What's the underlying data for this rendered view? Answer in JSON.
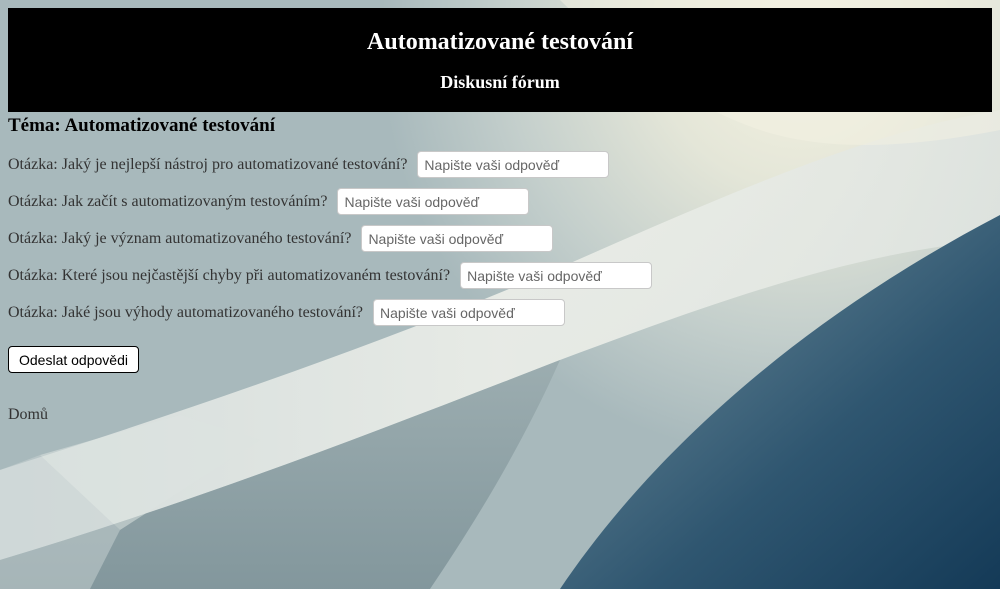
{
  "header": {
    "title": "Automatizované testování",
    "subtitle": "Diskusní fórum"
  },
  "topic": "Téma: Automatizované testování",
  "questions": [
    {
      "label": "Otázka: Jaký je nejlepší nástroj pro automatizované testování?",
      "placeholder": "Napište vaši odpověď",
      "value": ""
    },
    {
      "label": "Otázka: Jak začít s automatizovaným testováním?",
      "placeholder": "Napište vaši odpověď",
      "value": ""
    },
    {
      "label": "Otázka: Jaký je význam automatizovaného testování?",
      "placeholder": "Napište vaši odpověď",
      "value": ""
    },
    {
      "label": "Otázka: Které jsou nejčastější chyby při automatizovaném testování?",
      "placeholder": "Napište vaši odpověď",
      "value": ""
    },
    {
      "label": "Otázka: Jaké jsou výhody automatizovaného testování?",
      "placeholder": "Napište vaši odpověď",
      "value": ""
    }
  ],
  "submit_label": "Odeslat odpovědi",
  "home_link": "Domů",
  "colors": {
    "header_bg": "#000000",
    "header_text": "#ffffff",
    "body_text": "#333333"
  }
}
